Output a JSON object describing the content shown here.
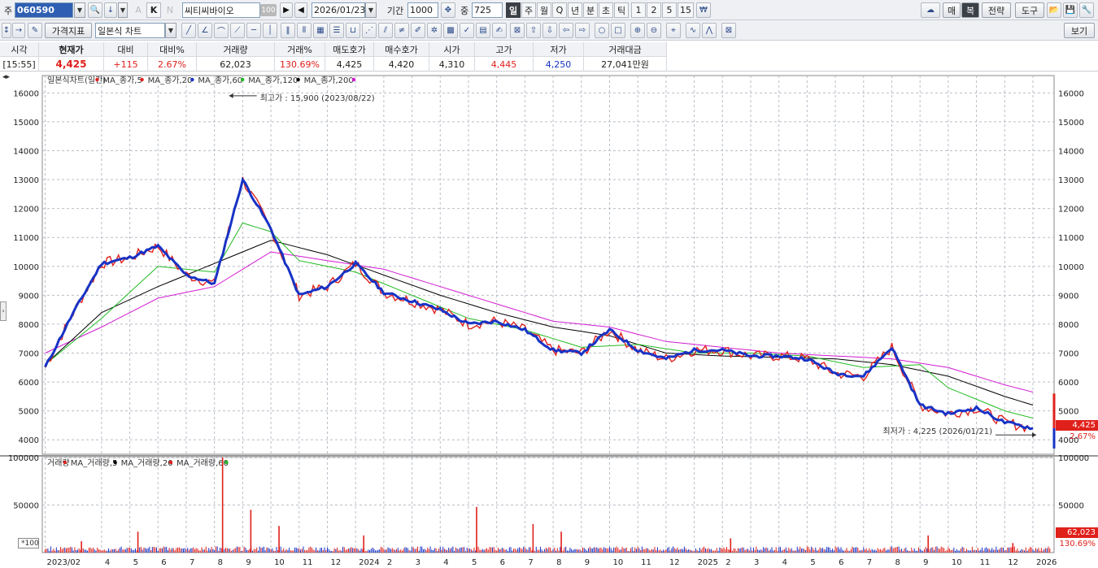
{
  "toolbar1": {
    "code_label": "주",
    "code_value": "060590",
    "letter_k": "K",
    "letter_a": "A",
    "letter_n": "N",
    "stock_name": "씨티씨바이오",
    "ratio_badge": "100",
    "date_value": "2026/01/23",
    "period_label": "기간",
    "period_value": "1000",
    "count_label": "중",
    "count_value": "725",
    "tabs": [
      "일",
      "주",
      "월",
      "Q",
      "년",
      "분",
      "초",
      "틱",
      "1",
      "2",
      "5",
      "15"
    ],
    "selected_tab": "일",
    "right_buttons": [
      "매",
      "복",
      "전략",
      "도구"
    ]
  },
  "toolbar2": {
    "indicator_button": "가격지표",
    "chart_type": "일본식 차트",
    "view_button": "보기"
  },
  "quote": {
    "headers": [
      "시각",
      "현재가",
      "대비",
      "대비%",
      "거래량",
      "거래%",
      "매도호가",
      "매수호가",
      "시가",
      "고가",
      "저가",
      "거래대금"
    ],
    "values": [
      "[15:55]",
      "4,425",
      "+115",
      "2.67%",
      "62,023",
      "130.69%",
      "4,425",
      "4,420",
      "4,310",
      "4,445",
      "4,250",
      "27,041만원"
    ]
  },
  "price_legend": [
    {
      "label": "일본식차트(일간)",
      "color": "#e0201b"
    },
    {
      "label": "MA_종가,5",
      "color": "#e0201b"
    },
    {
      "label": "MA_종가,20",
      "color": "#1733c6"
    },
    {
      "label": "MA_종가,60",
      "color": "#22bb22"
    },
    {
      "label": "MA_종가,120",
      "color": "#000000"
    },
    {
      "label": "MA_종가,200",
      "color": "#d21ad2"
    }
  ],
  "volume_legend": [
    {
      "label": "거래량",
      "color": "#e0201b"
    },
    {
      "label": "MA_거래량,5",
      "color": "#000000"
    },
    {
      "label": "MA_거래량,20",
      "color": "#e0201b"
    },
    {
      "label": "MA_거래량,60",
      "color": "#22bb22"
    }
  ],
  "annotations": {
    "high_label": "최고가 : 15,900 (2023/08/22)",
    "low_label": "최저가 : 4,225 (2026/01/21)",
    "current_price_tag": "4,425",
    "change_tag": "2.67%",
    "current_volume_tag": "62,023",
    "volume_ratio_tag": "130.69%",
    "volume_scale_tag": "*100"
  },
  "colors": {
    "up": "#e0201b",
    "down": "#1733c6",
    "ma5": "#1733c6",
    "ma20": "#22bb22",
    "ma120": "#000000",
    "ma200": "#d21ad2",
    "grid": "#b9bec7"
  },
  "chart_data": {
    "type": "line",
    "price_axis": {
      "ticks": [
        4000,
        5000,
        6000,
        7000,
        8000,
        9000,
        10000,
        11000,
        12000,
        13000,
        14000,
        15000,
        16000
      ],
      "ylim": [
        3500,
        16600
      ]
    },
    "volume_axis": {
      "ticks": [
        50000,
        100000
      ],
      "ylim": [
        0,
        100000
      ]
    },
    "x_labels": [
      "2023/02",
      "4",
      "5",
      "6",
      "7",
      "8",
      "9",
      "10",
      "11",
      "12",
      "2024",
      "2",
      "3",
      "4",
      "5",
      "6",
      "7",
      "8",
      "9",
      "10",
      "11",
      "12",
      "2025",
      "2",
      "3",
      "4",
      "5",
      "6",
      "7",
      "8",
      "9",
      "10",
      "11",
      "12",
      "2026"
    ],
    "x_dates": [
      "2023-02",
      "2023-04",
      "2023-05",
      "2023-06",
      "2023-07",
      "2023-08",
      "2023-09",
      "2023-10",
      "2023-11",
      "2023-12",
      "2024-01",
      "2024-02",
      "2024-03",
      "2024-04",
      "2024-05",
      "2024-06",
      "2024-07",
      "2024-08",
      "2024-09",
      "2024-10",
      "2024-11",
      "2024-12",
      "2025-01",
      "2025-02",
      "2025-03",
      "2025-04",
      "2025-05",
      "2025-06",
      "2025-07",
      "2025-08",
      "2025-09",
      "2025-10",
      "2025-11",
      "2025-12",
      "2026-01"
    ],
    "series": [
      {
        "name": "MA_종가,5",
        "x": [
          "2023-02",
          "2023-03",
          "2023-04",
          "2023-05",
          "2023-06",
          "2023-07",
          "2023-08",
          "2023-09",
          "2023-10",
          "2023-11",
          "2023-12",
          "2024-01",
          "2024-02",
          "2024-03",
          "2024-04",
          "2024-05",
          "2024-06",
          "2024-07",
          "2024-08",
          "2024-09",
          "2024-10",
          "2024-11",
          "2024-12",
          "2025-01",
          "2025-02",
          "2025-03",
          "2025-04",
          "2025-05",
          "2025-06",
          "2025-07",
          "2025-08",
          "2025-09",
          "2025-10",
          "2025-11",
          "2025-12",
          "2026-01"
        ],
        "values": [
          6500,
          8400,
          10100,
          10300,
          10700,
          9700,
          9400,
          13000,
          11300,
          9000,
          9300,
          10100,
          9100,
          8800,
          8500,
          8000,
          8100,
          7800,
          7100,
          7000,
          7800,
          7100,
          6800,
          7100,
          7100,
          6900,
          6900,
          6800,
          6300,
          6200,
          7200,
          5200,
          4900,
          5100,
          4600,
          4400
        ]
      },
      {
        "name": "MA_종가,20",
        "x": [
          "2023-02",
          "2023-04",
          "2023-06",
          "2023-08",
          "2023-09",
          "2023-10",
          "2023-11",
          "2024-01",
          "2024-03",
          "2024-05",
          "2024-07",
          "2024-09",
          "2024-11",
          "2025-01",
          "2025-03",
          "2025-05",
          "2025-07",
          "2025-09",
          "2025-10",
          "2025-12",
          "2026-01"
        ],
        "values": [
          6600,
          8200,
          10000,
          9800,
          11500,
          11200,
          10200,
          9800,
          9000,
          8200,
          7800,
          7200,
          7300,
          7000,
          7000,
          6900,
          6500,
          6600,
          5800,
          5000,
          4750
        ]
      },
      {
        "name": "MA_종가,120",
        "x": [
          "2023-02",
          "2023-04",
          "2023-06",
          "2023-08",
          "2023-10",
          "2023-12",
          "2024-02",
          "2024-04",
          "2024-06",
          "2024-08",
          "2024-10",
          "2024-12",
          "2025-02",
          "2025-04",
          "2025-06",
          "2025-08",
          "2025-10",
          "2025-12",
          "2026-01"
        ],
        "values": [
          6600,
          8400,
          9300,
          10100,
          10900,
          10400,
          9700,
          9000,
          8400,
          7900,
          7600,
          7000,
          6900,
          6850,
          6800,
          6600,
          6200,
          5500,
          5200
        ]
      },
      {
        "name": "MA_종가,200",
        "x": [
          "2023-02",
          "2023-04",
          "2023-06",
          "2023-08",
          "2023-10",
          "2023-12",
          "2024-02",
          "2024-04",
          "2024-06",
          "2024-08",
          "2024-10",
          "2024-12",
          "2025-02",
          "2025-04",
          "2025-06",
          "2025-08",
          "2025-10",
          "2025-12",
          "2026-01"
        ],
        "values": [
          7000,
          7900,
          8900,
          9300,
          10500,
          10200,
          9900,
          9300,
          8700,
          8100,
          7900,
          7400,
          7200,
          7000,
          6900,
          6800,
          6500,
          5900,
          5650
        ]
      },
      {
        "name": "거래량",
        "x": [
          "2023-03",
          "2023-05",
          "2023-08",
          "2023-09",
          "2023-10",
          "2024-01",
          "2024-05",
          "2024-07",
          "2024-08",
          "2025-02",
          "2025-09",
          "2025-12"
        ],
        "values": [
          12000,
          22000,
          100000,
          45000,
          28000,
          18000,
          48000,
          30000,
          22000,
          15000,
          18000,
          10000
        ]
      }
    ]
  }
}
